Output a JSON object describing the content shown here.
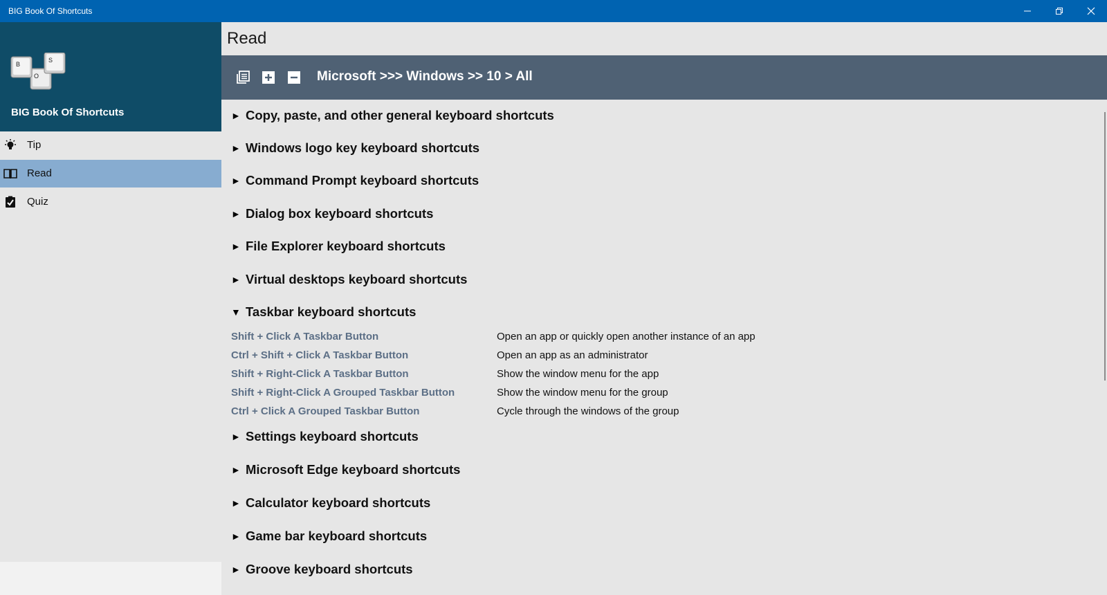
{
  "window": {
    "title": "BIG Book Of Shortcuts",
    "minimize_icon": "minimize-icon",
    "maximize_icon": "restore-icon",
    "close_icon": "close-icon"
  },
  "sidebar": {
    "brand_title": "BIG Book Of Shortcuts",
    "logo_keys": [
      "B",
      "O",
      "S"
    ],
    "items": [
      {
        "label": "Tip",
        "icon": "lightbulb-icon",
        "selected": false
      },
      {
        "label": "Read",
        "icon": "book-icon",
        "selected": true
      },
      {
        "label": "Quiz",
        "icon": "checklist-icon",
        "selected": false
      }
    ],
    "selected_color": "#87acd0",
    "brand_color": "#0f4c67"
  },
  "main": {
    "page_title": "Read",
    "toolbar": {
      "buttons": [
        "collapse-all-icon",
        "expand-all-icon",
        "collapse-icon"
      ],
      "breadcrumb": "Microsoft >>> Windows >> 10 > All",
      "background": "#4f6174"
    },
    "sections": [
      {
        "label": "Copy, paste, and other general keyboard shortcuts",
        "expanded": false
      },
      {
        "label": "Windows logo key keyboard shortcuts",
        "expanded": false
      },
      {
        "label": "Command Prompt keyboard shortcuts",
        "expanded": false
      },
      {
        "label": "Dialog box keyboard shortcuts",
        "expanded": false
      },
      {
        "label": "File Explorer keyboard shortcuts",
        "expanded": false
      },
      {
        "label": "Virtual desktops keyboard shortcuts",
        "expanded": false
      },
      {
        "label": "Taskbar keyboard shortcuts",
        "expanded": true
      },
      {
        "label": "Settings keyboard shortcuts",
        "expanded": false
      },
      {
        "label": "Microsoft Edge keyboard shortcuts",
        "expanded": false
      },
      {
        "label": "Calculator keyboard shortcuts",
        "expanded": false
      },
      {
        "label": "Game bar keyboard shortcuts",
        "expanded": false
      },
      {
        "label": "Groove keyboard shortcuts",
        "expanded": false
      }
    ],
    "arrow_collapsed": "►",
    "arrow_expanded": "▼",
    "taskbar_shortcuts": [
      {
        "keys": "Shift + Click A Taskbar Button",
        "desc": "Open an app or quickly open another instance of an app"
      },
      {
        "keys": "Ctrl + Shift + Click A Taskbar Button",
        "desc": "Open an app as an administrator"
      },
      {
        "keys": "Shift + Right-Click A Taskbar Button",
        "desc": "Show the window menu for the app"
      },
      {
        "keys": "Shift + Right-Click A Grouped Taskbar Button",
        "desc": "Show the window menu for the group"
      },
      {
        "keys": "Ctrl + Click A Grouped Taskbar Button",
        "desc": "Cycle through the windows of the group"
      }
    ],
    "shortcut_key_color": "#5c6f86"
  }
}
